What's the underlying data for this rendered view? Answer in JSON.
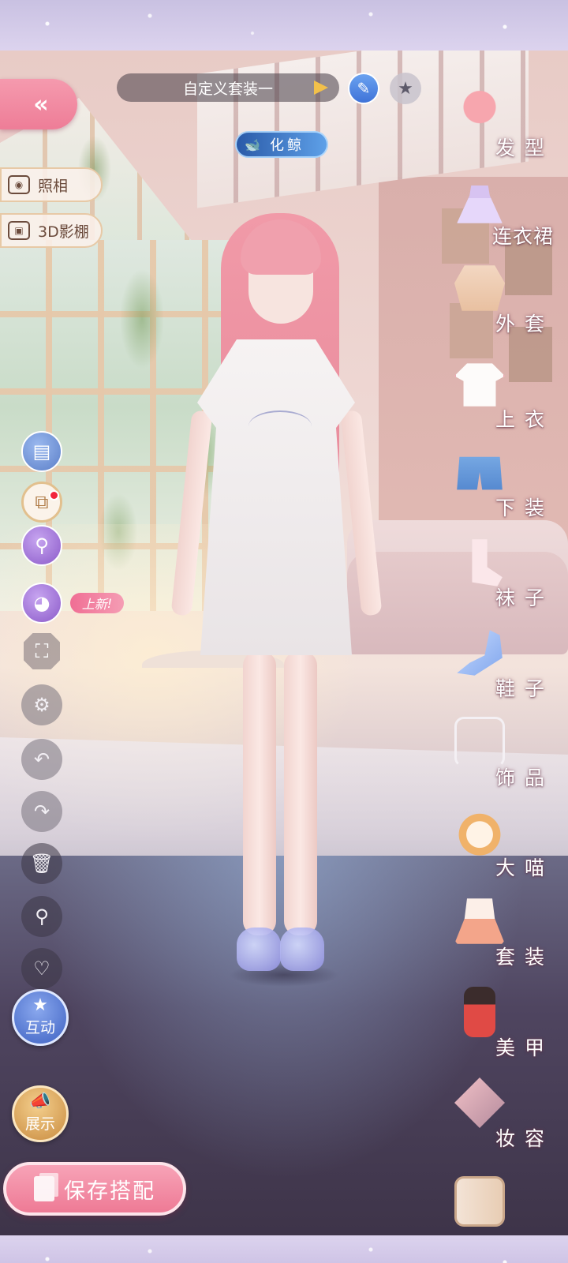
{
  "header": {
    "back_label": "«",
    "outfit_name": "自定义套装一",
    "edit_icon": "pencil-icon",
    "star_icon": "star-icon",
    "skin_badge": "化鲸"
  },
  "left_pills": {
    "photo_label": "照相",
    "studio_label": "3D影棚"
  },
  "tools": {
    "new_badge": "上新",
    "new_badge_mark": "!",
    "interact_label": "互动",
    "display_label": "展示"
  },
  "save_button": "保存搭配",
  "categories": [
    {
      "label": "发型",
      "icon": "hair-icon"
    },
    {
      "label": "连衣裙",
      "icon": "dress-icon"
    },
    {
      "label": "外套",
      "icon": "coat-icon"
    },
    {
      "label": "上衣",
      "icon": "top-icon"
    },
    {
      "label": "下装",
      "icon": "pants-icon"
    },
    {
      "label": "袜子",
      "icon": "socks-icon"
    },
    {
      "label": "鞋子",
      "icon": "shoes-icon"
    },
    {
      "label": "饰品",
      "icon": "accessory-icon"
    },
    {
      "label": "大喵",
      "icon": "cat-icon"
    },
    {
      "label": "套装",
      "icon": "outfit-set-icon"
    },
    {
      "label": "美甲",
      "icon": "nail-polish-icon"
    },
    {
      "label": "妆容",
      "icon": "makeup-icon"
    }
  ],
  "colors": {
    "accent_pink": "#ee7a95",
    "edit_blue": "#3f73d8",
    "badge_red": "#f2243c"
  }
}
